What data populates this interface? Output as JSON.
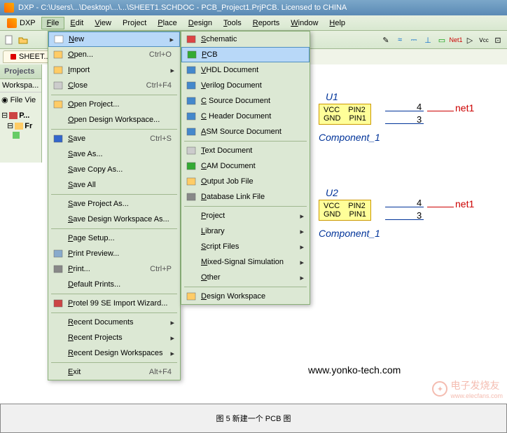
{
  "title": "DXP - C:\\Users\\...\\Desktop\\...\\...\\SHEET1.SCHDOC - PCB_Project1.PrjPCB. Licensed to CHINA",
  "menubar": {
    "dxp": "DXP",
    "items": [
      "File",
      "Edit",
      "View",
      "Project",
      "Place",
      "Design",
      "Tools",
      "Reports",
      "Window",
      "Help"
    ]
  },
  "tab": {
    "label": "SHEET..."
  },
  "projects": {
    "title": "Projects",
    "workspace": "Workspa...",
    "fileView": "File Vie",
    "tree": [
      "P...",
      "Fr",
      "..."
    ]
  },
  "fileMenu": [
    {
      "icon": "new",
      "label": "New",
      "arrow": true,
      "hl": true
    },
    {
      "icon": "open",
      "label": "Open...",
      "shortcut": "Ctrl+O"
    },
    {
      "icon": "import",
      "label": "Import",
      "arrow": true
    },
    {
      "icon": "close",
      "label": "Close",
      "shortcut": "Ctrl+F4"
    },
    {
      "sep": true
    },
    {
      "icon": "openproj",
      "label": "Open Project..."
    },
    {
      "icon": "",
      "label": "Open Design Workspace..."
    },
    {
      "sep": true
    },
    {
      "icon": "save",
      "label": "Save",
      "shortcut": "Ctrl+S"
    },
    {
      "icon": "",
      "label": "Save As..."
    },
    {
      "icon": "",
      "label": "Save Copy As..."
    },
    {
      "icon": "",
      "label": "Save All"
    },
    {
      "sep": true
    },
    {
      "icon": "",
      "label": "Save Project As..."
    },
    {
      "icon": "",
      "label": "Save Design Workspace As..."
    },
    {
      "sep": true
    },
    {
      "icon": "",
      "label": "Page Setup..."
    },
    {
      "icon": "preview",
      "label": "Print Preview..."
    },
    {
      "icon": "print",
      "label": "Print...",
      "shortcut": "Ctrl+P"
    },
    {
      "icon": "",
      "label": "Default Prints..."
    },
    {
      "sep": true
    },
    {
      "icon": "protel",
      "label": "Protel 99 SE Import Wizard..."
    },
    {
      "sep": true
    },
    {
      "icon": "",
      "label": "Recent Documents",
      "arrow": true
    },
    {
      "icon": "",
      "label": "Recent Projects",
      "arrow": true
    },
    {
      "icon": "",
      "label": "Recent Design Workspaces",
      "arrow": true
    },
    {
      "sep": true
    },
    {
      "icon": "",
      "label": "Exit",
      "shortcut": "Alt+F4"
    }
  ],
  "newMenu": [
    {
      "icon": "sch",
      "label": "Schematic"
    },
    {
      "icon": "pcb",
      "label": "PCB",
      "hl": true
    },
    {
      "icon": "vhdl",
      "label": "VHDL Document"
    },
    {
      "icon": "ver",
      "label": "Verilog Document"
    },
    {
      "icon": "c",
      "label": "C Source Document"
    },
    {
      "icon": "h",
      "label": "C Header Document"
    },
    {
      "icon": "asm",
      "label": "ASM Source Document"
    },
    {
      "sep": true
    },
    {
      "icon": "txt",
      "label": "Text Document"
    },
    {
      "icon": "cam",
      "label": "CAM Document"
    },
    {
      "icon": "out",
      "label": "Output Job File"
    },
    {
      "icon": "db",
      "label": "Database Link File"
    },
    {
      "sep": true
    },
    {
      "icon": "",
      "label": "Project",
      "arrow": true
    },
    {
      "icon": "",
      "label": "Library",
      "arrow": true
    },
    {
      "icon": "",
      "label": "Script Files",
      "arrow": true
    },
    {
      "icon": "",
      "label": "Mixed-Signal Simulation",
      "arrow": true
    },
    {
      "icon": "",
      "label": "Other",
      "arrow": true
    },
    {
      "sep": true
    },
    {
      "icon": "dw",
      "label": "Design Workspace"
    }
  ],
  "schematic": {
    "u1": {
      "des": "U1",
      "pins": [
        {
          "name": "VCC",
          "other": "PIN2",
          "num": "4"
        },
        {
          "name": "GND",
          "other": "PIN1",
          "num": "3"
        }
      ],
      "comp": "Component_1",
      "net": "net1"
    },
    "u2": {
      "des": "U2",
      "pins": [
        {
          "name": "VCC",
          "other": "PIN2",
          "num": "4"
        },
        {
          "name": "GND",
          "other": "PIN1",
          "num": "3"
        }
      ],
      "comp": "Component_1",
      "net": "net1"
    }
  },
  "watermark": "www.yonko-tech.com",
  "corner": {
    "brand": "电子发烧友",
    "url": "www.elecfans.com"
  },
  "caption": "图 5 新建一个 PCB 图"
}
